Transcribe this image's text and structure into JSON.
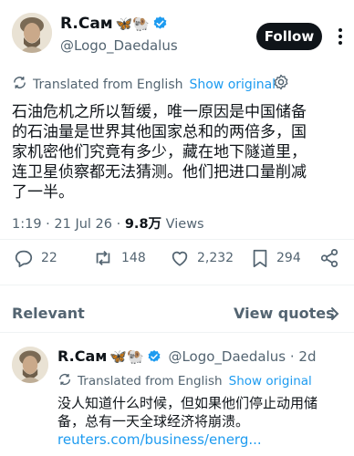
{
  "post": {
    "author_name": "R.Cам",
    "author_emoji": "🦋🐏",
    "handle": "@Logo_Daedalus",
    "follow_label": "Follow",
    "translated_label": "Translated from English",
    "show_original_label": "Show original",
    "body_lines": [
      "石油危机之所以暂缓，唯一原因是中国储备",
      "的石油量是世界其他国家总和的两倍多，国",
      "家机密他们究竟有多少，藏在地下隧道里，",
      "连卫星侦察都无法猜测。他们把进口量削减",
      "了一半。"
    ],
    "time": "1:19",
    "separator": "·",
    "date": "21 Jul 26",
    "views_count": "9.8万",
    "views_label": "Views",
    "replies": "22",
    "reposts": "148",
    "likes": "2,232",
    "bookmarks": "294"
  },
  "sort": {
    "relevant_label": "Relevant",
    "view_quotes_label": "View quotes"
  },
  "reply": {
    "author_name": "R.Cам",
    "author_emoji": "🦋🐏",
    "handle": "@Logo_Daedalus",
    "age": "· 2d",
    "translated_label": "Translated from English",
    "show_original_label": "Show original",
    "text_lines": [
      "没人知道什么时候，但如果他们停止动用储",
      "备，总有一天全球经济将崩溃。"
    ],
    "link_text": "reuters.com/business/energ..."
  },
  "colors": {
    "accent": "#1d9bf0",
    "text_primary": "#0f1419",
    "text_secondary": "#536471",
    "follow_bg": "#0f1419"
  }
}
